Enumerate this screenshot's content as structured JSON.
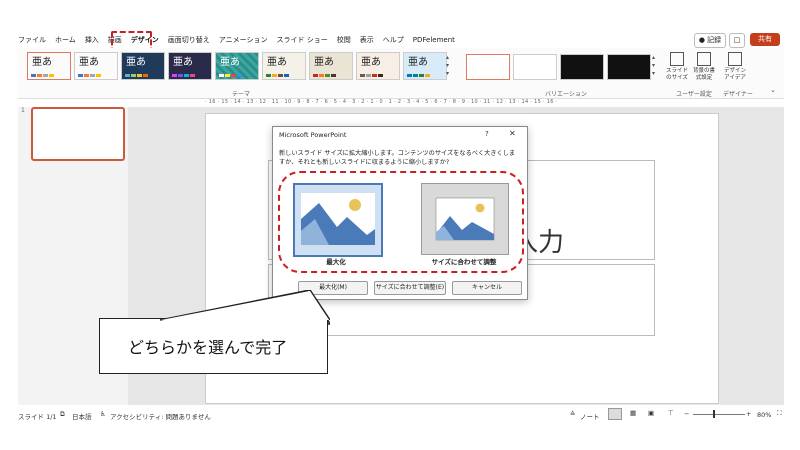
{
  "menu": {
    "tabs": [
      "ファイル",
      "ホーム",
      "挿入",
      "描画",
      "デザイン",
      "画面切り替え",
      "アニメーション",
      "スライド ショー",
      "校閲",
      "表示",
      "ヘルプ",
      "PDFelement"
    ],
    "active_tab": "デザイン"
  },
  "top_right": {
    "record": "● 記録",
    "comment": "□",
    "share": "共有"
  },
  "ribbon": {
    "theme_sample_text": "亜あ",
    "themes_group_label": "テーマ",
    "variations_group_label": "バリエーション",
    "user_settings_group_label": "ユーザー設定",
    "designer_group_label": "デザイナー",
    "slide_size_label": "スライドのサイズ",
    "background_format_label": "背景の書式設定",
    "design_ideas_label": "デザインアイデア"
  },
  "ruler_text": "· 16 · 15 · 14 · 13 · 12 · 11 · 10 · 9 · 8 · 7 · 6 · 5 · 4 · 3 · 2 · 1 · 0 · 1 · 2 · 3 · 4 · 5 · 6 · 7 · 8 · 9 · 10 · 11 · 12 · 13 · 14 · 15 · 16 ·",
  "slide_panel": {
    "slide_number": "1"
  },
  "slide": {
    "title_placeholder_partial": "入力"
  },
  "dialog": {
    "title": "Microsoft PowerPoint",
    "help": "?",
    "close": "✕",
    "message": "新しいスライド サイズに拡大縮小します。コンテンツのサイズをなるべく大きくしますか、それとも新しいスライドに収まるように縮小しますか?",
    "option_maximize": "最大化",
    "option_fit": "サイズに合わせて調整",
    "btn_maximize": "最大化(M)",
    "btn_fit": "サイズに合わせて調整(E)",
    "btn_cancel": "キャンセル"
  },
  "callout": {
    "text": "どちらかを選んで完了"
  },
  "status": {
    "slide_info": "スライド 1/1",
    "language": "日本語",
    "accessibility": "アクセシビリティ: 問題ありません",
    "notes": "ノート",
    "zoom_minus": "−",
    "zoom_plus": "+",
    "zoom": "80%"
  },
  "colors": {
    "accent_red": "#cc1f1f",
    "share": "#c43e1c",
    "selection_blue": "#4a7ab8"
  }
}
